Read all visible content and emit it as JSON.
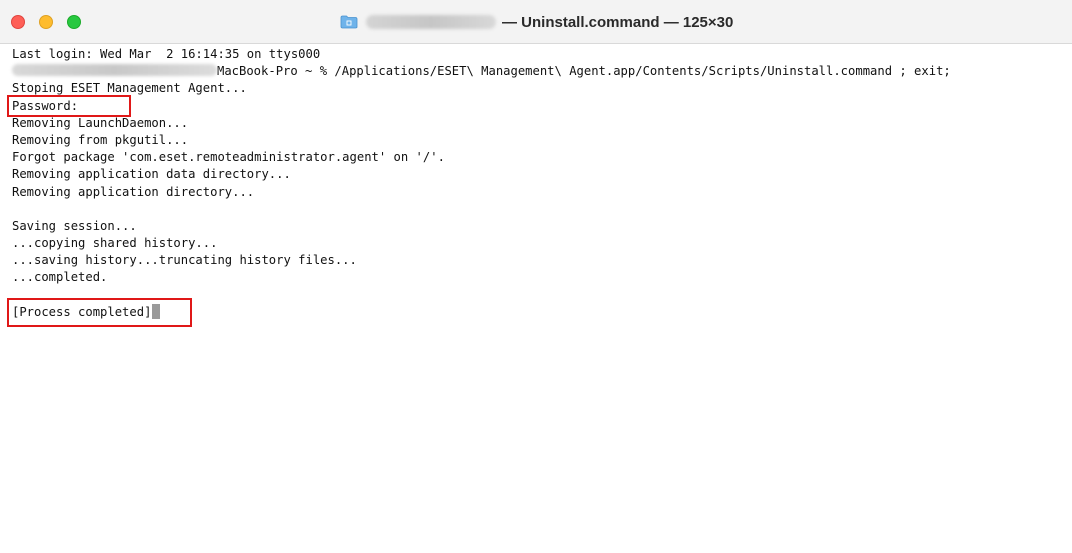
{
  "window": {
    "title": "— Uninstall.command — 125×30",
    "user_redacted": true,
    "traffic_lights": [
      "close",
      "minimize",
      "zoom"
    ]
  },
  "terminal": {
    "lines": [
      "Last login: Wed Mar  2 16:14:35 on ttys000",
      "MacBook-Pro ~ % /Applications/ESET\\ Management\\ Agent.app/Contents/Scripts/Uninstall.command ; exit;",
      "Stoping ESET Management Agent...",
      "Password:",
      "Removing LaunchDaemon...",
      "Removing from pkgutil...",
      "Forgot package 'com.eset.remoteadministrator.agent' on '/'.",
      "Removing application data directory...",
      "Removing application directory...",
      "",
      "Saving session...",
      "...copying shared history...",
      "...saving history...truncating history files...",
      "...completed.",
      "",
      "[Process completed]"
    ],
    "highlighted": [
      "Password:",
      "[Process completed]"
    ]
  },
  "colors": {
    "highlight": "#e01818",
    "close": "#fe5f57",
    "minimize": "#febc2e",
    "zoom": "#28c840"
  }
}
